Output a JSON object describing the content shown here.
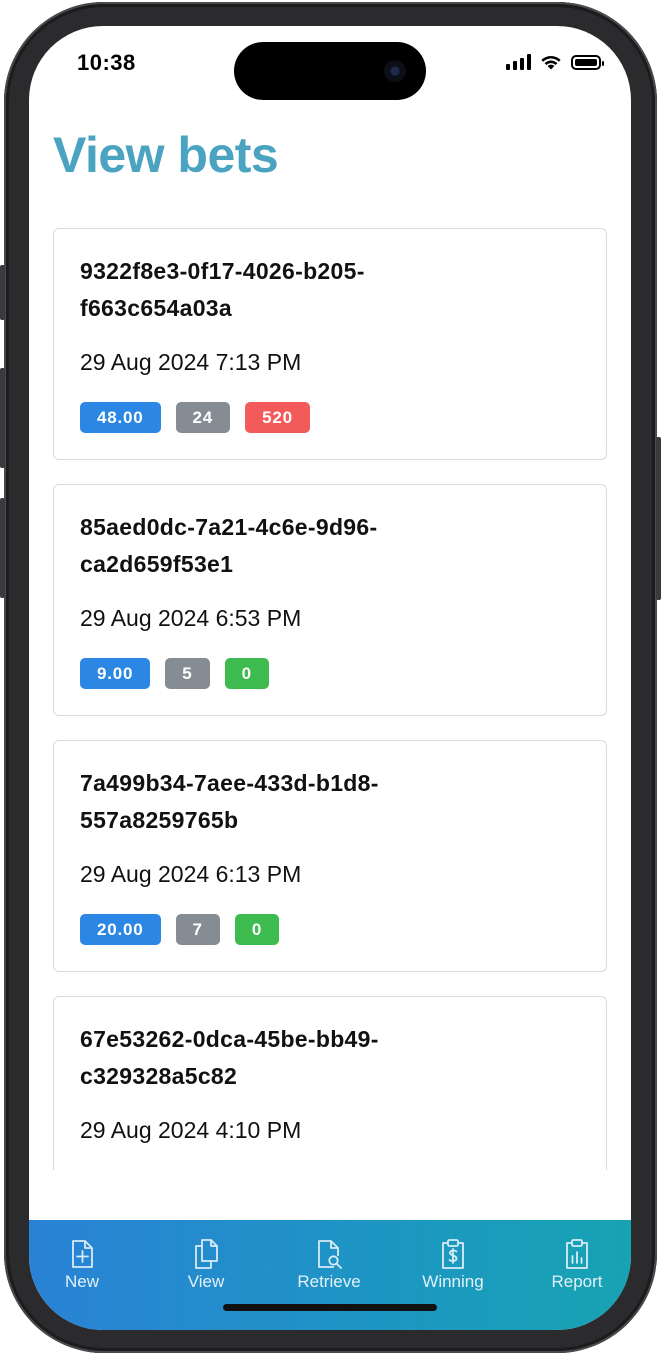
{
  "status_bar": {
    "time": "10:38"
  },
  "page": {
    "title": "View bets"
  },
  "bets": [
    {
      "id_line1": "9322f8e3-0f17-4026-b205-",
      "id_line2": "f663c654a03a",
      "date": "29 Aug 2024 7:13 PM",
      "amount": "48.00",
      "count": "24",
      "result": "520",
      "result_color": "#f35a5a"
    },
    {
      "id_line1": "85aed0dc-7a21-4c6e-9d96-",
      "id_line2": "ca2d659f53e1",
      "date": "29 Aug 2024 6:53 PM",
      "amount": "9.00",
      "count": "5",
      "result": "0",
      "result_color": "#3dbb4e"
    },
    {
      "id_line1": "7a499b34-7aee-433d-b1d8-",
      "id_line2": "557a8259765b",
      "date": "29 Aug 2024 6:13 PM",
      "amount": "20.00",
      "count": "7",
      "result": "0",
      "result_color": "#3dbb4e"
    },
    {
      "id_line1": "67e53262-0dca-45be-bb49-",
      "id_line2": "c329328a5c82",
      "date": "29 Aug 2024 4:10 PM"
    }
  ],
  "tabs": [
    {
      "label": "New",
      "icon": "file-plus-icon"
    },
    {
      "label": "View",
      "icon": "copy-files-icon"
    },
    {
      "label": "Retrieve",
      "icon": "file-search-icon"
    },
    {
      "label": "Winning",
      "icon": "dollar-clipboard-icon"
    },
    {
      "label": "Report",
      "icon": "report-clipboard-icon"
    }
  ],
  "colors": {
    "title": "#4ba3c2",
    "amount_badge": "#2b87e3",
    "count_badge": "#858c94"
  }
}
